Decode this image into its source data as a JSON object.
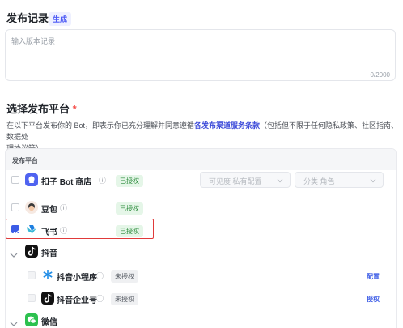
{
  "record": {
    "title": "发布记录",
    "generate_label": "生成",
    "placeholder": "输入版本记录",
    "counter": "0/2000"
  },
  "platform": {
    "title": "选择发布平台",
    "required_mark": "*",
    "desc_prefix": "在以下平台发布你的 Bot，即表示你已充分理解并同意遵循",
    "desc_link": "各发布渠道服务条款",
    "desc_suffix": "（包括但不限于任何隐私政策、社区指南、数据处",
    "desc_line2": "理协议等）。",
    "table_header": "发布平台",
    "rows": [
      {
        "name": "扣子 Bot 商店",
        "info": "ⓘ",
        "status": "已授权",
        "select1": "可见度  私有配置",
        "select2": "分类  角色"
      },
      {
        "name": "豆包",
        "info": "ⓘ",
        "status": "已授权"
      },
      {
        "name": "飞书",
        "info": "ⓘ",
        "status": "已授权"
      },
      {
        "name": "抖音"
      },
      {
        "name": "抖音小程序",
        "info": "ⓘ",
        "status": "未授权",
        "action": "配置"
      },
      {
        "name": "抖音企业号",
        "info": "ⓘ",
        "status": "未授权",
        "action": "授权"
      },
      {
        "name": "微信"
      }
    ]
  },
  "colors": {
    "accent": "#3c5ce6",
    "highlight_border": "#e03a3a",
    "authorized": "#2a8a3a"
  }
}
